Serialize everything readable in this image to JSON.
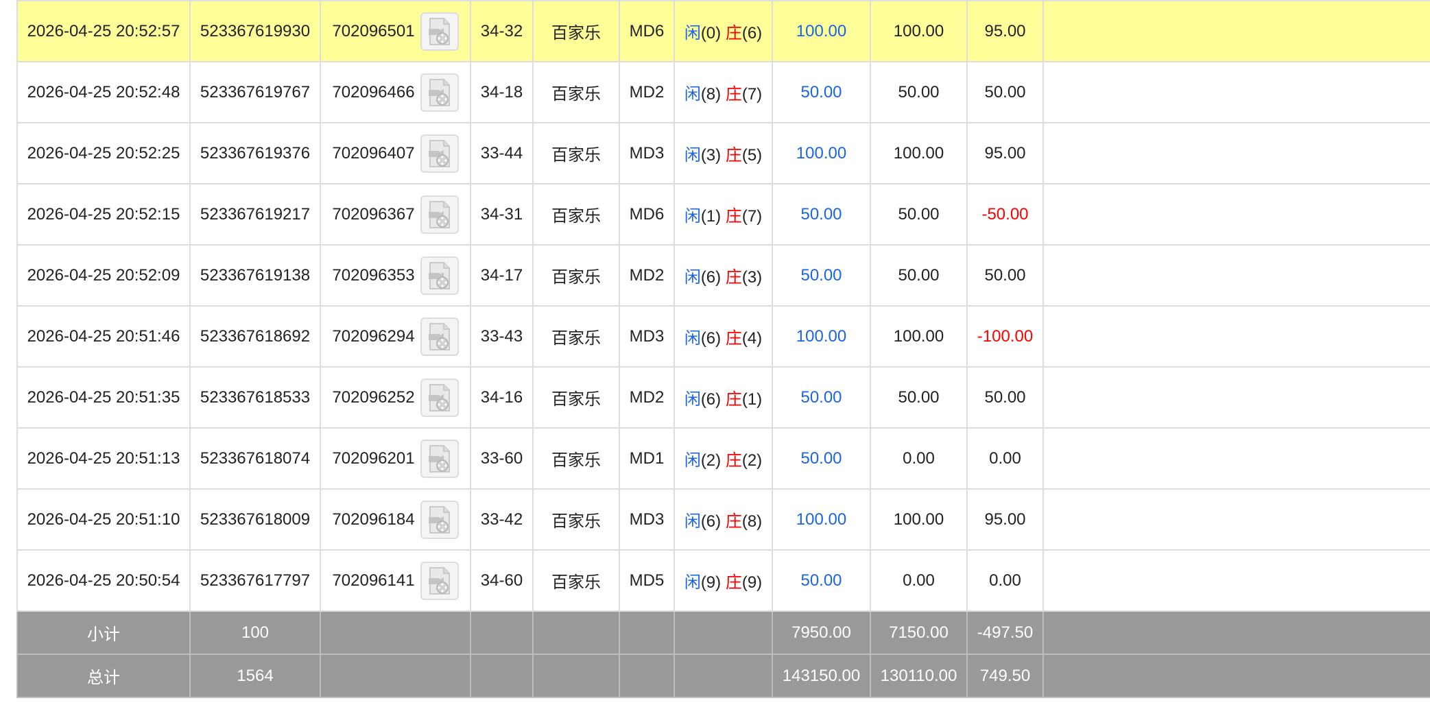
{
  "colors": {
    "highlight_row": "#ffff99",
    "summary_row": "#999999",
    "player_blue": "#1a64e6",
    "banker_red": "#ff0000",
    "negative_red": "#ff0000",
    "border": "#dddddd"
  },
  "icons": {
    "replay": "video-replay-icon"
  },
  "rows": [
    {
      "time": "2026-04-25 20:52:57",
      "bet_id": "523367619930",
      "round_id": "702096501",
      "shoe": "34-32",
      "game": "百家乐",
      "table": "MD6",
      "player_label": "闲",
      "player_score": "(0)",
      "banker_label": "庄",
      "banker_score": "(6)",
      "bet": "100.00",
      "valid_bet": "100.00",
      "win": "95.00",
      "win_negative": false,
      "highlight": true
    },
    {
      "time": "2026-04-25 20:52:48",
      "bet_id": "523367619767",
      "round_id": "702096466",
      "shoe": "34-18",
      "game": "百家乐",
      "table": "MD2",
      "player_label": "闲",
      "player_score": "(8)",
      "banker_label": "庄",
      "banker_score": "(7)",
      "bet": "50.00",
      "valid_bet": "50.00",
      "win": "50.00",
      "win_negative": false,
      "highlight": false
    },
    {
      "time": "2026-04-25 20:52:25",
      "bet_id": "523367619376",
      "round_id": "702096407",
      "shoe": "33-44",
      "game": "百家乐",
      "table": "MD3",
      "player_label": "闲",
      "player_score": "(3)",
      "banker_label": "庄",
      "banker_score": "(5)",
      "bet": "100.00",
      "valid_bet": "100.00",
      "win": "95.00",
      "win_negative": false,
      "highlight": false
    },
    {
      "time": "2026-04-25 20:52:15",
      "bet_id": "523367619217",
      "round_id": "702096367",
      "shoe": "34-31",
      "game": "百家乐",
      "table": "MD6",
      "player_label": "闲",
      "player_score": "(1)",
      "banker_label": "庄",
      "banker_score": "(7)",
      "bet": "50.00",
      "valid_bet": "50.00",
      "win": "-50.00",
      "win_negative": true,
      "highlight": false
    },
    {
      "time": "2026-04-25 20:52:09",
      "bet_id": "523367619138",
      "round_id": "702096353",
      "shoe": "34-17",
      "game": "百家乐",
      "table": "MD2",
      "player_label": "闲",
      "player_score": "(6)",
      "banker_label": "庄",
      "banker_score": "(3)",
      "bet": "50.00",
      "valid_bet": "50.00",
      "win": "50.00",
      "win_negative": false,
      "highlight": false
    },
    {
      "time": "2026-04-25 20:51:46",
      "bet_id": "523367618692",
      "round_id": "702096294",
      "shoe": "33-43",
      "game": "百家乐",
      "table": "MD3",
      "player_label": "闲",
      "player_score": "(6)",
      "banker_label": "庄",
      "banker_score": "(4)",
      "bet": "100.00",
      "valid_bet": "100.00",
      "win": "-100.00",
      "win_negative": true,
      "highlight": false
    },
    {
      "time": "2026-04-25 20:51:35",
      "bet_id": "523367618533",
      "round_id": "702096252",
      "shoe": "34-16",
      "game": "百家乐",
      "table": "MD2",
      "player_label": "闲",
      "player_score": "(6)",
      "banker_label": "庄",
      "banker_score": "(1)",
      "bet": "50.00",
      "valid_bet": "50.00",
      "win": "50.00",
      "win_negative": false,
      "highlight": false
    },
    {
      "time": "2026-04-25 20:51:13",
      "bet_id": "523367618074",
      "round_id": "702096201",
      "shoe": "33-60",
      "game": "百家乐",
      "table": "MD1",
      "player_label": "闲",
      "player_score": "(2)",
      "banker_label": "庄",
      "banker_score": "(2)",
      "bet": "50.00",
      "valid_bet": "0.00",
      "win": "0.00",
      "win_negative": false,
      "highlight": false
    },
    {
      "time": "2026-04-25 20:51:10",
      "bet_id": "523367618009",
      "round_id": "702096184",
      "shoe": "33-42",
      "game": "百家乐",
      "table": "MD3",
      "player_label": "闲",
      "player_score": "(6)",
      "banker_label": "庄",
      "banker_score": "(8)",
      "bet": "100.00",
      "valid_bet": "100.00",
      "win": "95.00",
      "win_negative": false,
      "highlight": false
    },
    {
      "time": "2026-04-25 20:50:54",
      "bet_id": "523367617797",
      "round_id": "702096141",
      "shoe": "34-60",
      "game": "百家乐",
      "table": "MD5",
      "player_label": "闲",
      "player_score": "(9)",
      "banker_label": "庄",
      "banker_score": "(9)",
      "bet": "50.00",
      "valid_bet": "0.00",
      "win": "0.00",
      "win_negative": false,
      "highlight": false
    }
  ],
  "subtotal": {
    "label": "小计",
    "count": "100",
    "bet": "7950.00",
    "valid_bet": "7150.00",
    "win": "-497.50",
    "win_negative": true
  },
  "total": {
    "label": "总计",
    "count": "1564",
    "bet": "143150.00",
    "valid_bet": "130110.00",
    "win": "749.50",
    "win_negative": false
  }
}
